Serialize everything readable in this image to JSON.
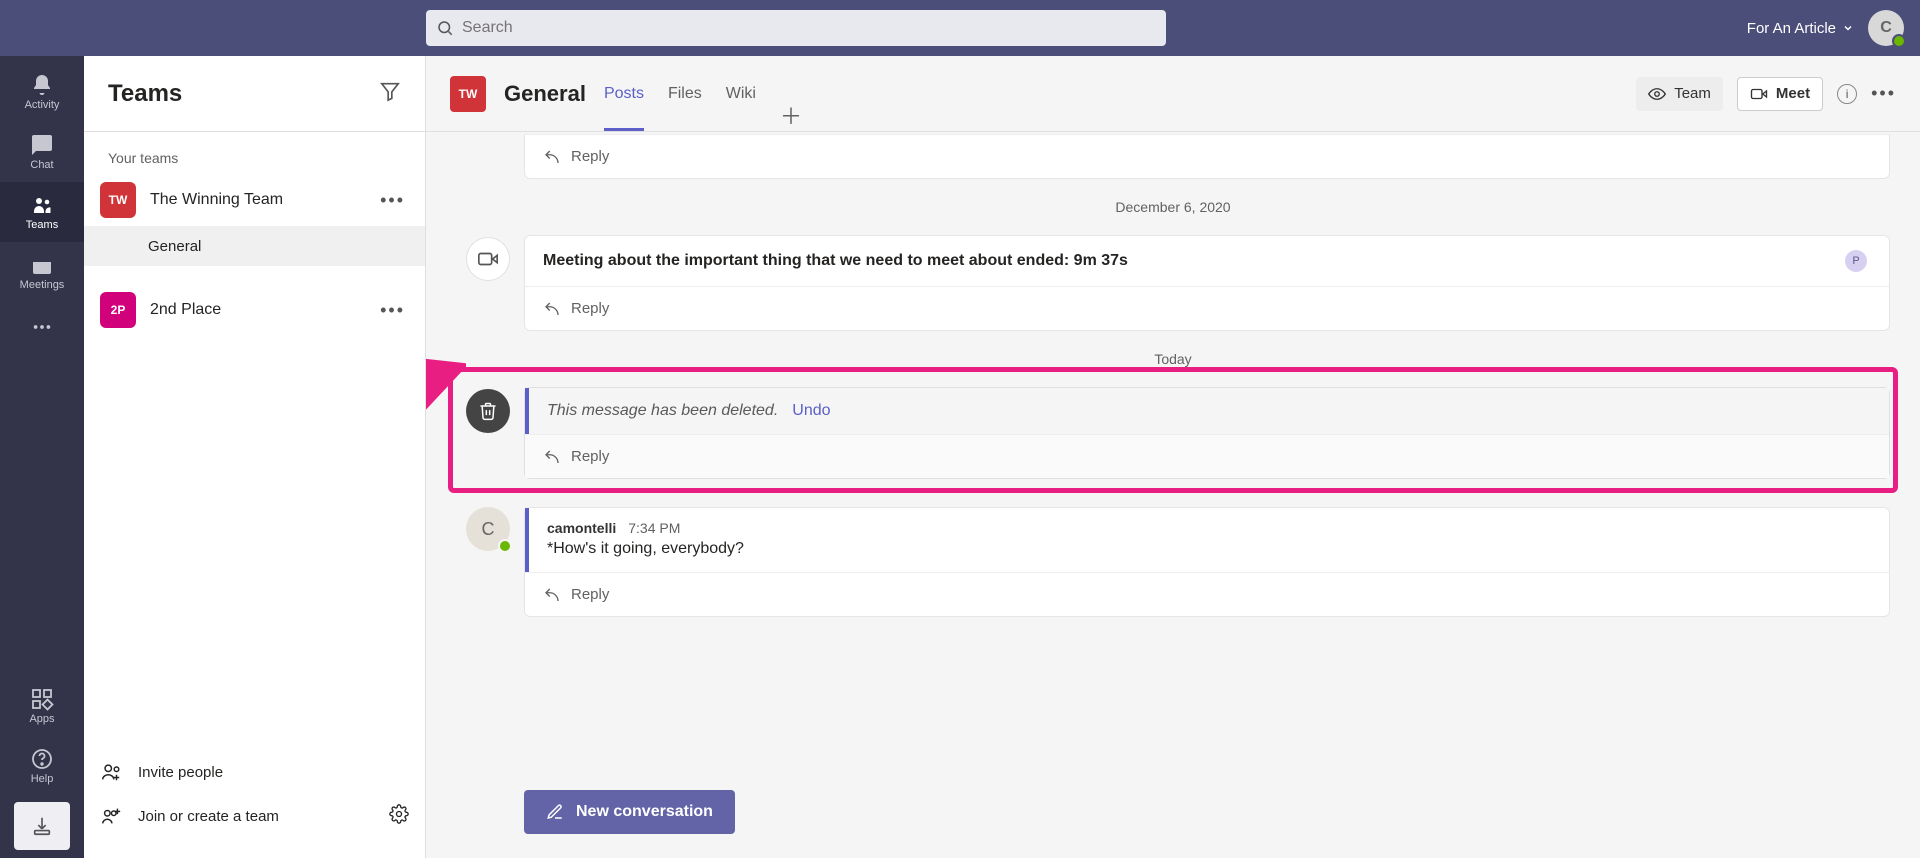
{
  "search": {
    "placeholder": "Search"
  },
  "org": {
    "name": "For An Article",
    "avatarInitial": "C"
  },
  "rail": {
    "activity": "Activity",
    "chat": "Chat",
    "teams": "Teams",
    "meetings": "Meetings",
    "apps": "Apps",
    "help": "Help"
  },
  "sidebar": {
    "title": "Teams",
    "sectionLabel": "Your teams",
    "teams": [
      {
        "name": "The Winning Team",
        "abbr": "TW",
        "color": "#d13438",
        "channels": [
          {
            "name": "General",
            "active": true
          }
        ]
      },
      {
        "name": "2nd Place",
        "abbr": "2P",
        "color": "#d1007b",
        "channels": []
      }
    ],
    "invite": "Invite people",
    "joinCreate": "Join or create a team"
  },
  "channel": {
    "abbr": "TW",
    "name": "General",
    "tabs": [
      {
        "label": "Posts",
        "active": true
      },
      {
        "label": "Files",
        "active": false
      },
      {
        "label": "Wiki",
        "active": false
      }
    ],
    "teamBtn": "Team",
    "meetBtn": "Meet"
  },
  "feed": {
    "date1": "December 6, 2020",
    "meetingEnded": "Meeting about the important thing that we need to meet about ended: 9m 37s",
    "participantInitial": "P",
    "date2": "Today",
    "deletedText": "This message has been deleted.",
    "undo": "Undo",
    "msgAuthor": "camontelli",
    "msgTime": "7:34 PM",
    "msgText": "*How's it going, everybody?",
    "reply": "Reply",
    "newConversation": "New conversation"
  }
}
